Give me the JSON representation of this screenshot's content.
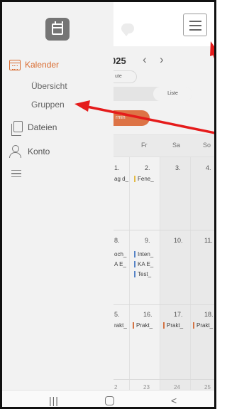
{
  "header": {
    "year_label": "025",
    "prev_icon": "chevron-left-icon",
    "next_icon": "chevron-right-icon",
    "menu_icon": "hamburger-icon",
    "chat_icon": "chat-bubble-icon"
  },
  "controls": {
    "today_label": "ute",
    "week_label": "che",
    "list_label": "Liste",
    "new_label": "rmin"
  },
  "day_headers": [
    "o",
    "Fr",
    "Sa",
    "So"
  ],
  "weeks": [
    {
      "days": [
        "1.",
        "2.",
        "3.",
        "4."
      ],
      "events": [
        {
          "col": 0,
          "text": "ag d_"
        },
        {
          "col": 1,
          "text": "Fene_",
          "color": "#f0c64a"
        }
      ]
    },
    {
      "days": [
        "8.",
        "9.",
        "10.",
        "11."
      ],
      "events": [
        {
          "col": 0,
          "text": "och_"
        },
        {
          "col": 0,
          "text": "A E_"
        },
        {
          "col": 1,
          "text": "Inten_",
          "color": "#5b8bd1"
        },
        {
          "col": 1,
          "text": "KA E_",
          "color": "#5b8bd1"
        },
        {
          "col": 1,
          "text": "Test_",
          "color": "#5b8bd1"
        }
      ]
    },
    {
      "days": [
        "5.",
        "16.",
        "17.",
        "18."
      ],
      "events": [
        {
          "col": 0,
          "text": "rakt_"
        },
        {
          "col": 1,
          "text": "Prakt_",
          "color": "#e07a48"
        },
        {
          "col": 2,
          "text": "Prakt_",
          "color": "#e07a48"
        },
        {
          "col": 3,
          "text": "Prakt_",
          "color": "#e07a48"
        }
      ]
    },
    {
      "days": [
        "2",
        "23",
        "24",
        "25"
      ]
    }
  ],
  "drawer": {
    "logo_icon": "calendar-logo-icon",
    "items": [
      {
        "label": "Kalender",
        "icon": "calendar-icon",
        "active": true
      },
      {
        "label": "Übersicht"
      },
      {
        "label": "Gruppen"
      },
      {
        "label": "Dateien",
        "icon": "file-icon"
      },
      {
        "label": "Konto",
        "icon": "user-icon"
      }
    ],
    "more_icon": "menu-lines-icon"
  },
  "navbar": {
    "recents": "|||",
    "back": "<"
  },
  "colors": {
    "accent": "#d96b2f",
    "annotation_arrow": "#e51b1b",
    "drawer_bg": "#f2f2f2"
  }
}
